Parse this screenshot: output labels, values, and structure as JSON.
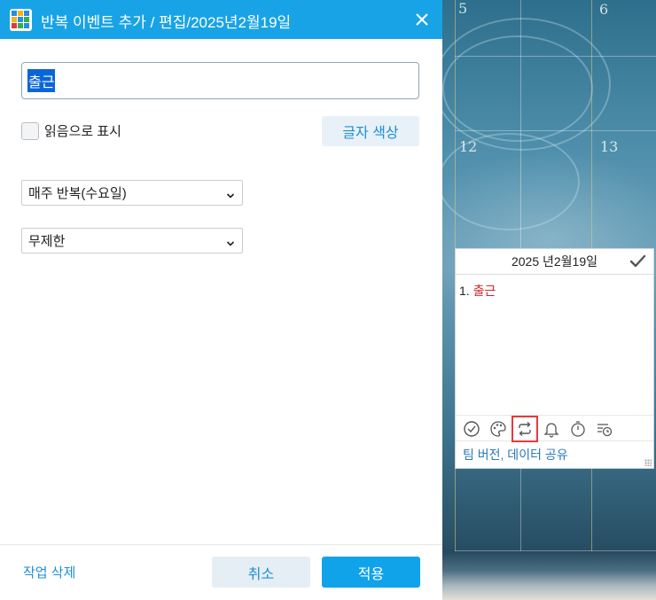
{
  "dialog": {
    "title": "반복 이벤트 추가 / 편집/2025년2월19일",
    "event_title_value": "출근",
    "show_as_read_label": "읽음으로 표시",
    "text_color_label": "글자 색상",
    "repeat_select_value": "매주 반복(수요일)",
    "end_select_value": "무제한",
    "delete_label": "작업 삭제",
    "cancel_label": "취소",
    "apply_label": "적용"
  },
  "calendar": {
    "dates": [
      "5",
      "6",
      "12",
      "13"
    ],
    "widget": {
      "date_header": "2025 년2월19일",
      "items": [
        {
          "number": "1.",
          "text": "출근"
        }
      ],
      "footer_link": "팀 버전, 데이터 공유",
      "tools": [
        "complete-icon",
        "palette-icon",
        "repeat-icon",
        "bell-icon",
        "timer-icon",
        "list-clock-icon"
      ]
    }
  },
  "colors": {
    "titlebar": "#18a3e6",
    "accent": "#1e8fd3",
    "event_red": "#d0262b",
    "highlight_box": "#e33b3b"
  }
}
